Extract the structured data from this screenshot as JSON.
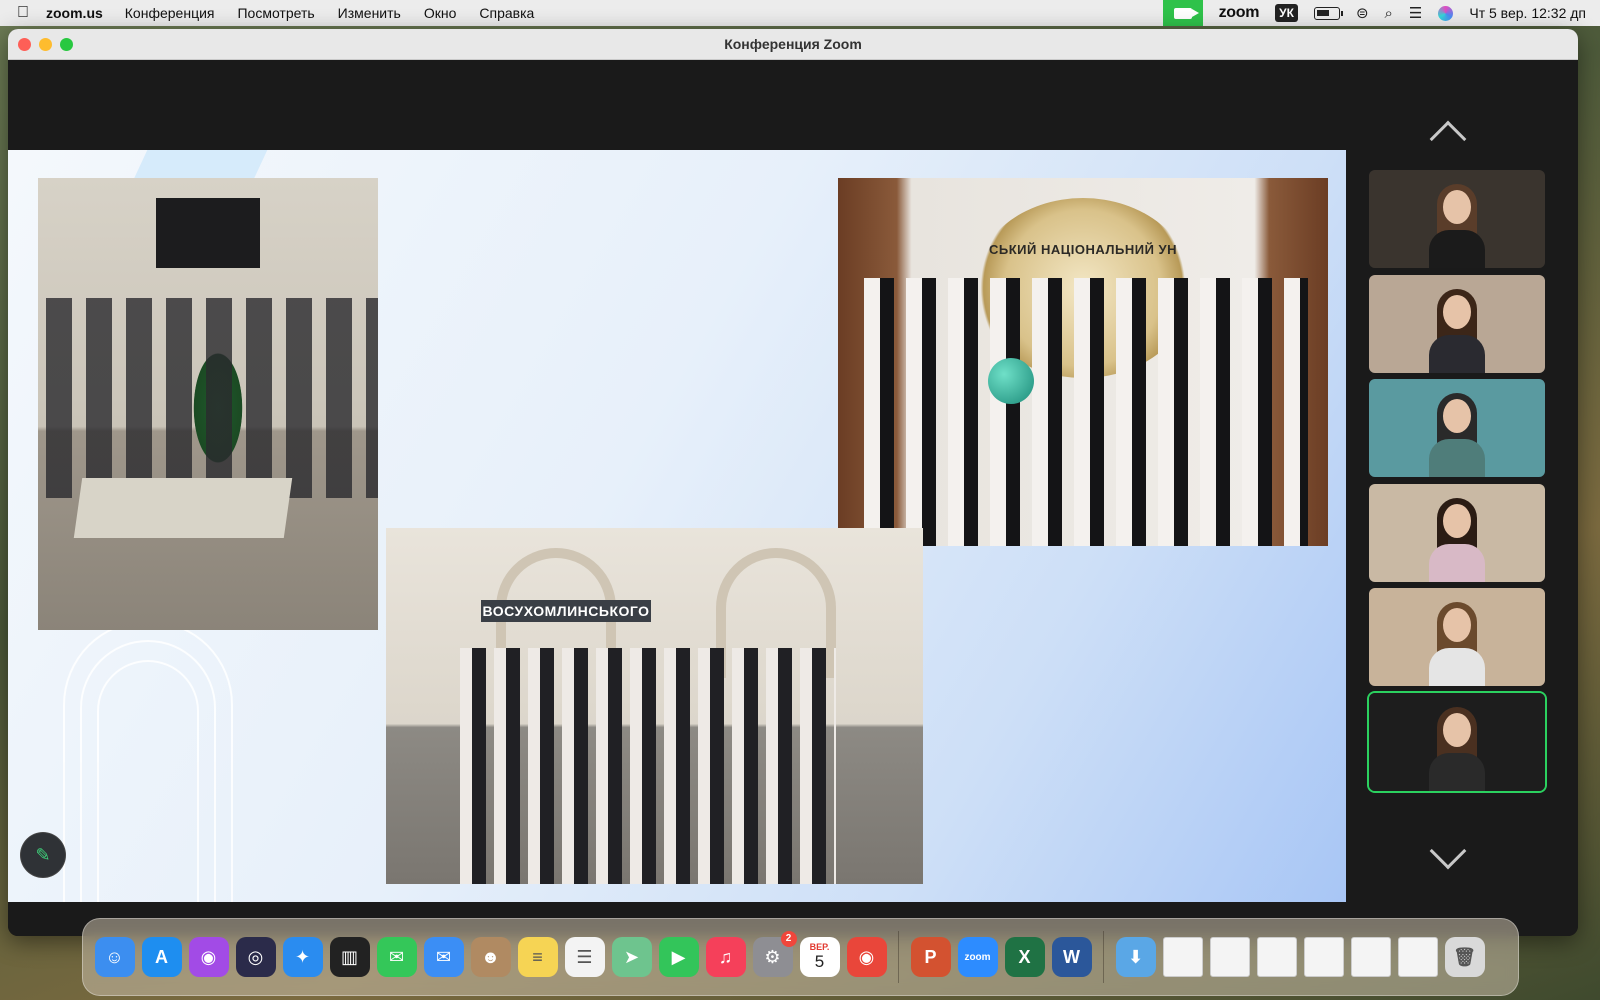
{
  "menubar": {
    "app_name": "zoom.us",
    "items": [
      "Конференция",
      "Посмотреть",
      "Изменить",
      "Окно",
      "Справка"
    ],
    "zoom_label": "zoom",
    "input_language": "УК",
    "clock": "Чт 5 вер.  12:32 дп"
  },
  "window": {
    "title": "Конференция Zoom"
  },
  "slide": {
    "award_banner_text": "СЬКИЙ НАЦІОНАЛЬНИЙ УН",
    "building_sign_text": "ВОСУХОМЛИНСЬКОГО"
  },
  "participants": {
    "tiles": [
      {
        "name": "participant-1",
        "bg": "#3a342e",
        "hair": "#5a3d2a",
        "body": "#1b1b1b"
      },
      {
        "name": "participant-2",
        "bg": "#b9a795",
        "hair": "#3c2618",
        "body": "#2a2a30"
      },
      {
        "name": "participant-3",
        "bg": "#5a9aa0",
        "hair": "#2a2a2a",
        "body": "#4f7d7a"
      },
      {
        "name": "participant-4",
        "bg": "#c9b9a4",
        "hair": "#2b1c14",
        "body": "#d8b9c6"
      },
      {
        "name": "participant-5",
        "bg": "#c8b39a",
        "hair": "#6b4a2d",
        "body": "#e5e5e5"
      },
      {
        "name": "participant-6",
        "bg": "#1d1d1d",
        "hair": "#4a3020",
        "body": "#2a2a2a",
        "active": true
      }
    ]
  },
  "dock": {
    "apps": [
      {
        "name": "finder-icon",
        "color": "#3c8ef0",
        "glyph": "☺"
      },
      {
        "name": "app-store-icon",
        "color": "#1e8ef0",
        "glyph": "A"
      },
      {
        "name": "podcasts-icon",
        "color": "#a24be6",
        "glyph": "◉"
      },
      {
        "name": "siri-icon",
        "color": "#2b2b4a",
        "glyph": "◎"
      },
      {
        "name": "safari-icon",
        "color": "#2a8cf0",
        "glyph": "✦"
      },
      {
        "name": "piano-icon",
        "color": "#222222",
        "glyph": "▥"
      },
      {
        "name": "messages-icon",
        "color": "#34c759",
        "glyph": "✉"
      },
      {
        "name": "mail-icon",
        "color": "#3b8ef5",
        "glyph": "✉"
      },
      {
        "name": "contacts-icon",
        "color": "#b08a62",
        "glyph": "☻"
      },
      {
        "name": "notes-icon",
        "color": "#f6d454",
        "glyph": "≡"
      },
      {
        "name": "reminders-icon",
        "color": "#f3f3f3",
        "glyph": "☰"
      },
      {
        "name": "maps-icon",
        "color": "#6ec48e",
        "glyph": "➤"
      },
      {
        "name": "facetime-icon",
        "color": "#33c55a",
        "glyph": "▶"
      },
      {
        "name": "music-icon",
        "color": "#f5405a",
        "glyph": "♫"
      },
      {
        "name": "system-settings-icon",
        "color": "#8e8e93",
        "glyph": "⚙",
        "badge": "2"
      },
      {
        "name": "calendar-icon",
        "calendar": true,
        "month": "ВЕР.",
        "day": "5"
      },
      {
        "name": "chrome-icon",
        "color": "#e9463a",
        "glyph": "◉"
      }
    ],
    "apps2": [
      {
        "name": "powerpoint-icon",
        "color": "#d35230",
        "glyph": "P"
      },
      {
        "name": "zoom-icon",
        "color": "#2d8cff",
        "glyph": "zoom"
      },
      {
        "name": "excel-icon",
        "color": "#1f7244",
        "glyph": "X"
      },
      {
        "name": "word-icon",
        "color": "#2b579a",
        "glyph": "W"
      }
    ],
    "files": [
      {
        "name": "downloads-folder-icon",
        "color": "#5aa7e6",
        "glyph": "⬇"
      },
      {
        "name": "document-thumbnail-icon"
      },
      {
        "name": "document-thumbnail-icon"
      },
      {
        "name": "document-thumbnail-icon"
      },
      {
        "name": "document-thumbnail-icon"
      },
      {
        "name": "document-thumbnail-icon"
      },
      {
        "name": "document-thumbnail-icon"
      },
      {
        "name": "trash-icon",
        "color": "#d9d9d9",
        "glyph": "🗑"
      }
    ]
  }
}
